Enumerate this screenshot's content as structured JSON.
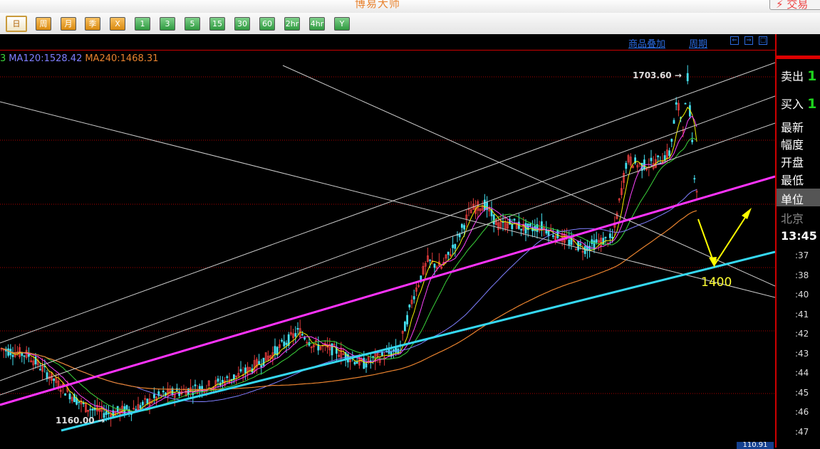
{
  "app": {
    "title": "博易大师",
    "trade_label": "⚡ 交易"
  },
  "toolbar": {
    "periods": [
      {
        "label": "日",
        "style": "active"
      },
      {
        "label": "周",
        "style": "orange"
      },
      {
        "label": "月",
        "style": "orange"
      },
      {
        "label": "季",
        "style": "orange"
      },
      {
        "label": "X",
        "style": "orange"
      },
      {
        "label": "1",
        "style": "green"
      },
      {
        "label": "3",
        "style": "green"
      },
      {
        "label": "5",
        "style": "green"
      },
      {
        "label": "15",
        "style": "green"
      },
      {
        "label": "30",
        "style": "green"
      },
      {
        "label": "60",
        "style": "green"
      },
      {
        "label": "2hr",
        "style": "green"
      },
      {
        "label": "4hr",
        "style": "green"
      },
      {
        "label": "Y",
        "style": "green"
      }
    ]
  },
  "header": {
    "ma_items": [
      {
        "text": "3",
        "color": "#3bd43b"
      },
      {
        "text": "MA120:1528.42",
        "color": "#7f7fff"
      },
      {
        "text": "MA240:1468.31",
        "color": "#e8822e"
      }
    ],
    "overlay_label": "商品叠加",
    "period_label": "周期",
    "arrows": [
      "⇐",
      "⇒",
      "□"
    ]
  },
  "right_panel": {
    "sell_label": "卖出",
    "sell_value": "1",
    "buy_label": "买入",
    "buy_value": "1",
    "fields": [
      "最新",
      "幅度",
      "开盘",
      "最低"
    ],
    "unit_label": "单位",
    "city_label": "北京",
    "time": "13:45",
    "times": [
      ":37",
      ":38",
      ":40",
      ":41",
      ":42",
      ":43",
      ":44",
      ":45",
      ":46",
      ":47"
    ]
  },
  "bottom_tag": "110.91",
  "chart_data": {
    "type": "candlestick",
    "high_label": "1703.60",
    "low_label": "1160.00",
    "target_label": "1400",
    "key_prices": {
      "high": 1703.6,
      "low": 1160.0,
      "target": 1400
    },
    "moving_averages": [
      {
        "name": "MA120",
        "value": 1528.42,
        "color": "#7f7fff"
      },
      {
        "name": "MA240",
        "value": 1468.31,
        "color": "#e8822e"
      }
    ],
    "trendlines": [
      {
        "name": "support",
        "color": "#35d8f2"
      },
      {
        "name": "mid-channel",
        "color": "#ff33ff"
      },
      {
        "name": "channel",
        "color": "#cccccc"
      }
    ],
    "colors": {
      "up": "#e23b3b",
      "down": "#44e0f0",
      "ma5": "#f2f200",
      "ma10": "#ff44ff",
      "ma20": "#3bd43b"
    }
  }
}
